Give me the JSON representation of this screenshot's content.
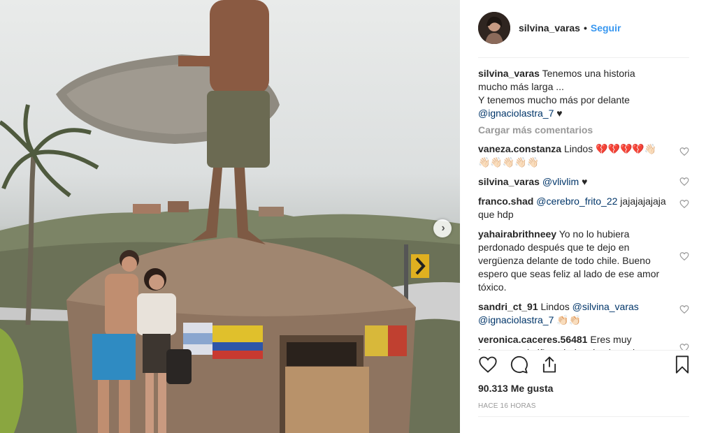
{
  "post": {
    "photo_alt": "",
    "next_icon": "chevron-right-icon"
  },
  "header": {
    "username": "silvina_varas",
    "separator": "•",
    "follow_label": "Seguir"
  },
  "caption": {
    "user": "silvina_varas",
    "line1": " Tenemos una historia mucho más larga ...",
    "line2": "Y tenemos mucho más por delante",
    "mention": "@ignaciolastra_7",
    "suffix": " ♥"
  },
  "load_more_label": "Cargar más comentarios",
  "comments": [
    {
      "user": "vaneza.constanza",
      "text": " Lindos 💔💔💔💔👋🏻👋🏻👋🏻👋🏻👋🏻👋🏻",
      "mention": ""
    },
    {
      "user": "silvina_varas",
      "text": " ♥",
      "mention": "@vlivlim"
    },
    {
      "user": "franco.shad",
      "mention": "@cerebro_frito_22",
      "text": " jajajajajaja que hdp"
    },
    {
      "user": "yahairabrithneey",
      "text": " Yo no lo hubiera perdonado después que te dejo en vergüenza delante de todo chile. Bueno espero que seas feliz al lado de ese amor tóxico.",
      "mention": ""
    },
    {
      "user": "sandri_ct_91",
      "text": " Lindos ",
      "mention": "@silvina_varas",
      "mention2": "@ignaciolastra_7",
      "text2": " 👏🏻👏🏻"
    },
    {
      "user": "veronica.caceres.56481",
      "text": " Eres muy hermosa mi niña saludos desde curico",
      "mention": ""
    }
  ],
  "actions": {
    "like_icon": "heart-icon",
    "comment_icon": "comment-icon",
    "share_icon": "share-icon",
    "save_icon": "bookmark-icon"
  },
  "likes_label": "90.313 Me gusta",
  "time_label": "HACE 16 HORAS"
}
